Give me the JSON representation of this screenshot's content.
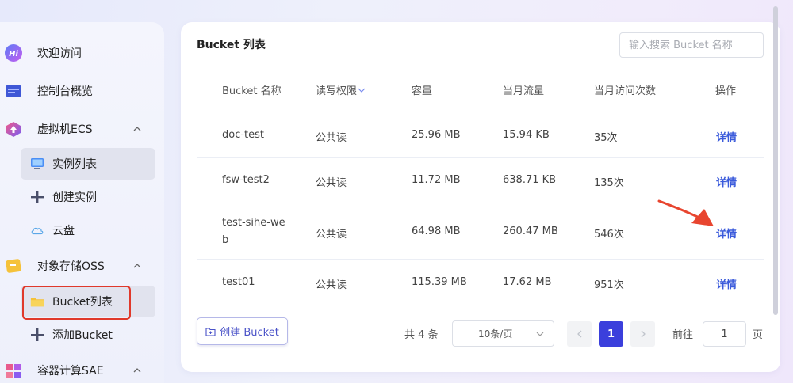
{
  "sidebar": {
    "items": [
      {
        "label": "欢迎访问",
        "icon": "hi-icon"
      },
      {
        "label": "控制台概览",
        "icon": "dashboard-icon"
      },
      {
        "label": "虚拟机ECS",
        "icon": "ecs-icon"
      },
      {
        "label": "对象存储OSS",
        "icon": "oss-icon"
      },
      {
        "label": "容器计算SAE",
        "icon": "sae-icon"
      }
    ],
    "subitems": [
      {
        "label": "实例列表",
        "icon": "monitor-icon"
      },
      {
        "label": "创建实例",
        "icon": "plus-icon"
      },
      {
        "label": "云盘",
        "icon": "cloud-icon"
      },
      {
        "label": "Bucket列表",
        "icon": "folder-icon"
      },
      {
        "label": "添加Bucket",
        "icon": "plus-icon"
      }
    ]
  },
  "main": {
    "title": "Bucket 列表",
    "search_placeholder": "输入搜索 Bucket 名称",
    "columns": [
      "Bucket 名称",
      "读写权限",
      "容量",
      "当月流量",
      "当月访问次数",
      "操作"
    ],
    "rows": [
      {
        "name": "doc-test",
        "perm": "公共读",
        "capacity": "25.96 MB",
        "traffic": "15.94 KB",
        "visits": "35次",
        "action": "详情"
      },
      {
        "name": "fsw-test2",
        "perm": "公共读",
        "capacity": "11.72 MB",
        "traffic": "638.71 KB",
        "visits": "135次",
        "action": "详情"
      },
      {
        "name": "test-sihe-we\nb",
        "name_line1": "test-sihe-we",
        "name_line2": "b",
        "perm": "公共读",
        "capacity": "64.98 MB",
        "traffic": "260.47 MB",
        "visits": "546次",
        "action": "详情"
      },
      {
        "name": "test01",
        "perm": "公共读",
        "capacity": "115.39 MB",
        "traffic": "17.62 MB",
        "visits": "951次",
        "action": "详情"
      }
    ],
    "create_button": "创建 Bucket",
    "pagination": {
      "total": "共 4 条",
      "page_size": "10条/页",
      "current_page": "1",
      "goto_label": "前往",
      "goto_value": "1",
      "page_suffix": "页"
    }
  },
  "colors": {
    "accent": "#3b3fdc",
    "link": "#3b5bdb",
    "highlight": "#e0392b",
    "arrow": "#e8452f"
  }
}
